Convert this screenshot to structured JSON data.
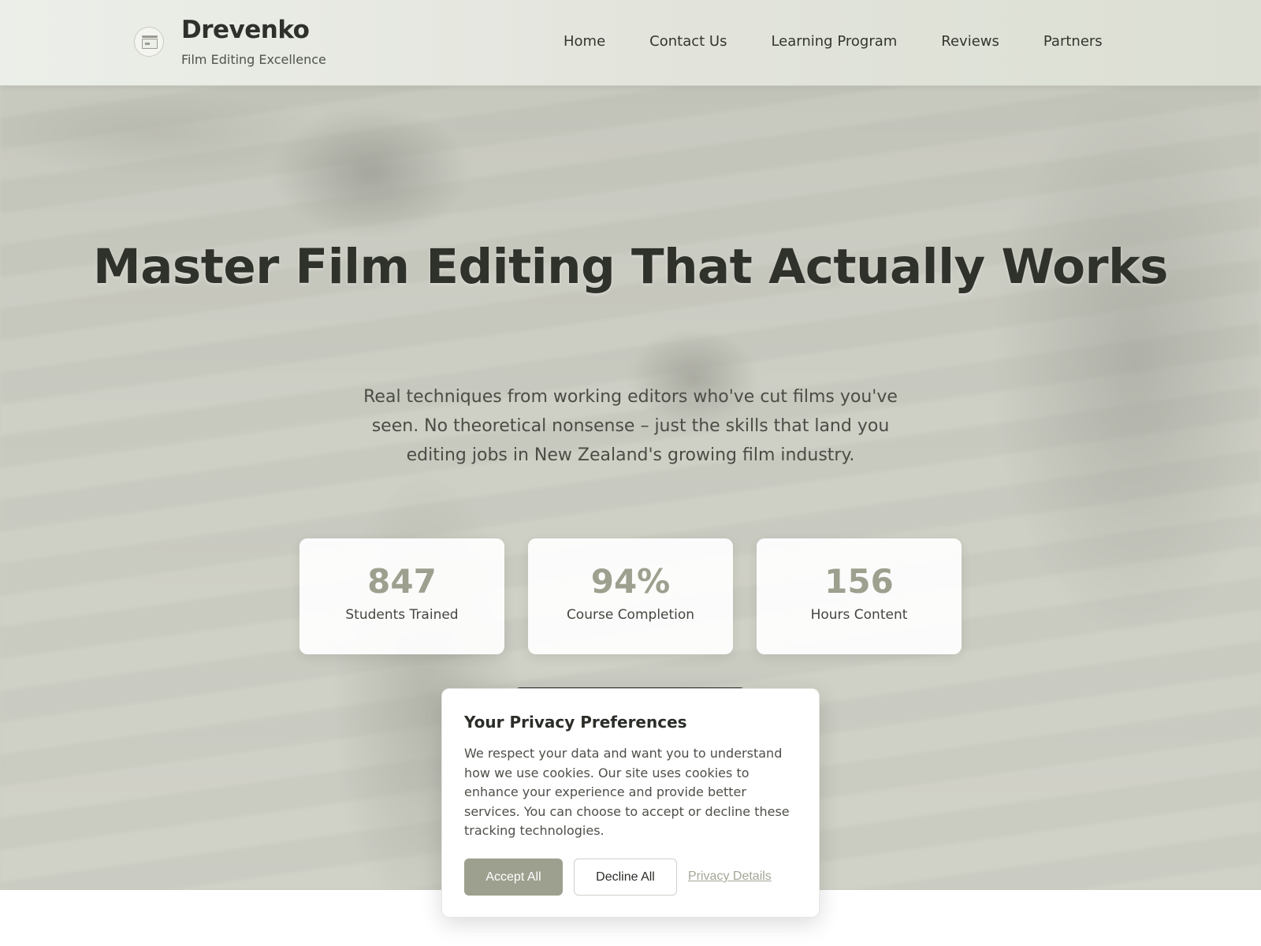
{
  "header": {
    "brand_name": "Drevenko",
    "brand_tagline": "Film Editing Excellence",
    "logo_icon": "film-clapper-icon",
    "nav": [
      {
        "label": "Home"
      },
      {
        "label": "Contact Us"
      },
      {
        "label": "Learning Program"
      },
      {
        "label": "Reviews"
      },
      {
        "label": "Partners"
      }
    ]
  },
  "hero": {
    "title": "Master Film Editing That Actually Works",
    "subtitle": "Real techniques from working editors who've cut films you've seen. No theoretical nonsense – just the skills that land you editing jobs in New Zealand's growing film industry.",
    "stats": [
      {
        "value": "847",
        "label": "Students Trained"
      },
      {
        "value": "94%",
        "label": "Course Completion"
      },
      {
        "value": "156",
        "label": "Hours Content"
      }
    ]
  },
  "cookie_banner": {
    "title": "Your Privacy Preferences",
    "text": "We respect your data and want you to understand how we use cookies. Our site uses cookies to enhance your experience and provide better services. You can choose to accept or decline these tracking technologies.",
    "accept_label": "Accept All",
    "decline_label": "Decline All",
    "details_label": "Privacy Details"
  },
  "colors": {
    "accent": "#9ea08f",
    "text_dark": "#2f312b",
    "header_bg": "#e3e5dd"
  }
}
